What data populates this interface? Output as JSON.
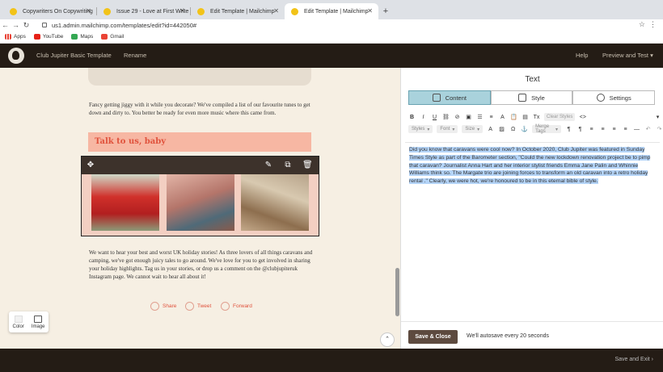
{
  "browser": {
    "tabs": [
      {
        "title": "Copywriters On Copywriting"
      },
      {
        "title": "Issue 29 - Love at First Write"
      },
      {
        "title": "Edit Template | Mailchimp"
      },
      {
        "title": "Edit Template | Mailchimp"
      }
    ],
    "new_tab": "+",
    "url": "us1.admin.mailchimp.com/templates/edit?id=442050#",
    "bookmarks": [
      "Apps",
      "YouTube",
      "Maps",
      "Gmail"
    ]
  },
  "header": {
    "template_name": "Club Jupiter Basic Template",
    "rename": "Rename",
    "help": "Help",
    "preview": "Preview and Test"
  },
  "preview": {
    "para1": "Fancy getting jiggy with it while you decorate? We've compiled a list of our favourite tunes to get down and dirty to. You better be ready for even more music where this came from.",
    "heading": "Talk to us, baby",
    "para2": "We want to hear your best and worst UK holiday stories! As three lovers of all things caravans and camping, we've got enough juicy tales to go around. We've love for you to get involved in sharing your holiday highlights. Tag us in your stories, or drop us a comment on the @clubjupiteruk Instagram page. We cannot wait to hear all about it!",
    "share": [
      "Share",
      "Tweet",
      "Forward"
    ],
    "color_label": "Color",
    "image_label": "Image"
  },
  "panel": {
    "title": "Text",
    "tabs": [
      "Content",
      "Style",
      "Settings"
    ],
    "clear_styles": "Clear Styles",
    "dropdowns": [
      "Styles",
      "Font",
      "Size",
      "Merge Tags"
    ],
    "editor_text": "Did you know that caravans were cool now? In October 2020, Club Jupiter was featured in Sunday Times Style as part of the Barometer section, \"Could the new lockdown renovation project be to pimp that caravan? Journalist Anna Hart and her interior stylist friends Emma Jane Palin and Whinnie Williams think so. The Margate trio are joining forces to transform an old caravan into a retro holiday rental .\" Clearly, we were hot, we're honoured to be in this eternal bible of style.",
    "save_close": "Save & Close",
    "autosave": "We'll autosave every 20 seconds"
  },
  "footer": {
    "save_exit": "Save and Exit"
  },
  "colors": {
    "header_bg": "#241c15",
    "canvas_bg": "#f6efe3",
    "accent_red": "#e0523c",
    "heading_bg": "#f7b7a3",
    "active_tab": "#a9d2dc",
    "selection": "#b4d4f8"
  }
}
